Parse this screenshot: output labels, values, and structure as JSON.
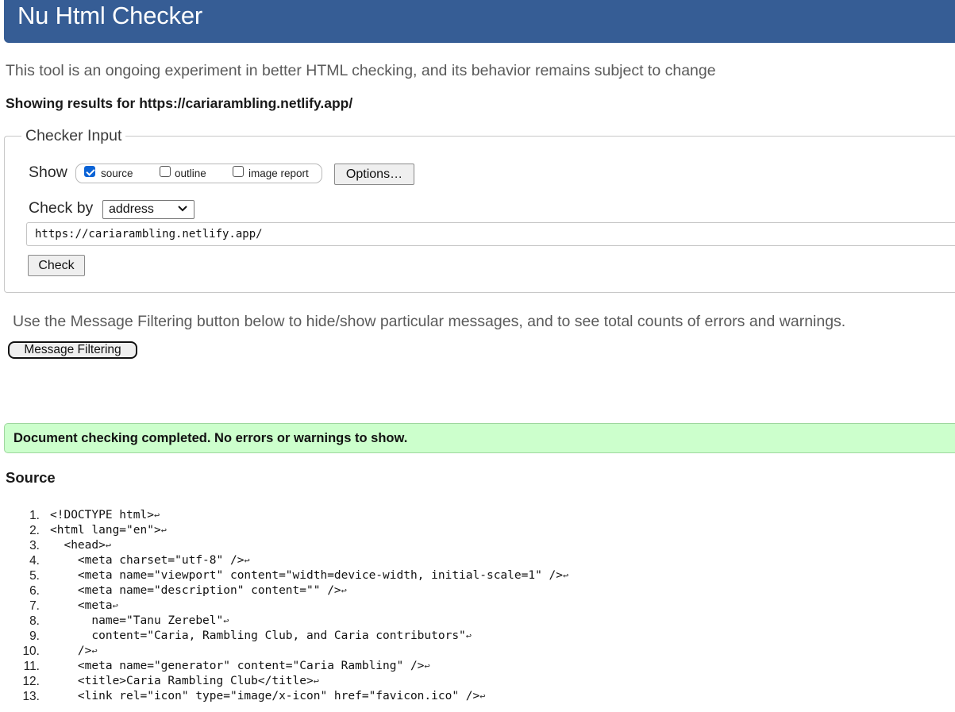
{
  "header": {
    "title": "Nu Html Checker"
  },
  "intro": "This tool is an ongoing experiment in better HTML checking, and its behavior remains subject to change",
  "results_heading": "Showing results for https://cariarambling.netlify.app/",
  "checker_input": {
    "legend": "Checker Input",
    "show_label": "Show",
    "options": [
      {
        "label": "source",
        "checked": true
      },
      {
        "label": "outline",
        "checked": false
      },
      {
        "label": "image report",
        "checked": false
      }
    ],
    "options_button": "Options…",
    "check_by_label": "Check by",
    "check_by_value": "address",
    "url_value": "https://cariarambling.netlify.app/",
    "check_button": "Check"
  },
  "filter_note": "Use the Message Filtering button below to hide/show particular messages, and to see total counts of errors and warnings.",
  "filter_button": "Message Filtering",
  "status_message": "Document checking completed. No errors or warnings to show.",
  "source": {
    "heading": "Source",
    "lines": [
      {
        "num": "1.",
        "code": "<!DOCTYPE html>"
      },
      {
        "num": "2.",
        "code": "<html lang=\"en\">"
      },
      {
        "num": "3.",
        "code": "  <head>"
      },
      {
        "num": "4.",
        "code": "    <meta charset=\"utf-8\" />"
      },
      {
        "num": "5.",
        "code": "    <meta name=\"viewport\" content=\"width=device-width, initial-scale=1\" />"
      },
      {
        "num": "6.",
        "code": "    <meta name=\"description\" content=\"\" />"
      },
      {
        "num": "7.",
        "code": "    <meta"
      },
      {
        "num": "8.",
        "code": "      name=\"Tanu Zerebel\""
      },
      {
        "num": "9.",
        "code": "      content=\"Caria, Rambling Club, and Caria contributors\""
      },
      {
        "num": "10.",
        "code": "    />"
      },
      {
        "num": "11.",
        "code": "    <meta name=\"generator\" content=\"Caria Rambling\" />"
      },
      {
        "num": "12.",
        "code": "    <title>Caria Rambling Club</title>"
      },
      {
        "num": "13.",
        "code": "    <link rel=\"icon\" type=\"image/x-icon\" href=\"favicon.ico\" />"
      }
    ],
    "line_end_glyph": "↩"
  },
  "colors": {
    "header_bg": "#365d95",
    "success_bg": "#ccffcc",
    "checkbox_checked": "#0b63d6"
  }
}
